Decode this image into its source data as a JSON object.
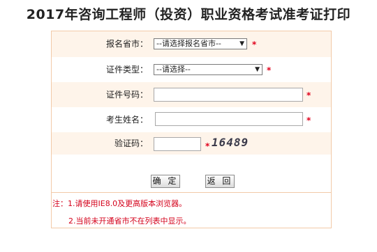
{
  "title": "2017年咨询工程师（投资）职业资格考试准考证打印",
  "form": {
    "province": {
      "label": "报名省市：",
      "value": "--请选择报名省市--"
    },
    "id_type": {
      "label": "证件类型：",
      "value": "--请选择--"
    },
    "id_number": {
      "label": "证件号码：",
      "value": ""
    },
    "name": {
      "label": "考生姓名：",
      "value": ""
    },
    "captcha": {
      "label": "验证码：",
      "value": "",
      "image_text": "16489"
    },
    "required_mark": "*",
    "confirm_label": "确 定",
    "back_label": "返 回"
  },
  "notes": {
    "line1": "注：1.请使用IE8.0及更高版本浏览器。",
    "line2": "2.当前未开通省市不在列表中显示。"
  },
  "colors": {
    "row_bg": "#fef4ea",
    "border": "#f2caa8",
    "required": "#e0001b"
  }
}
